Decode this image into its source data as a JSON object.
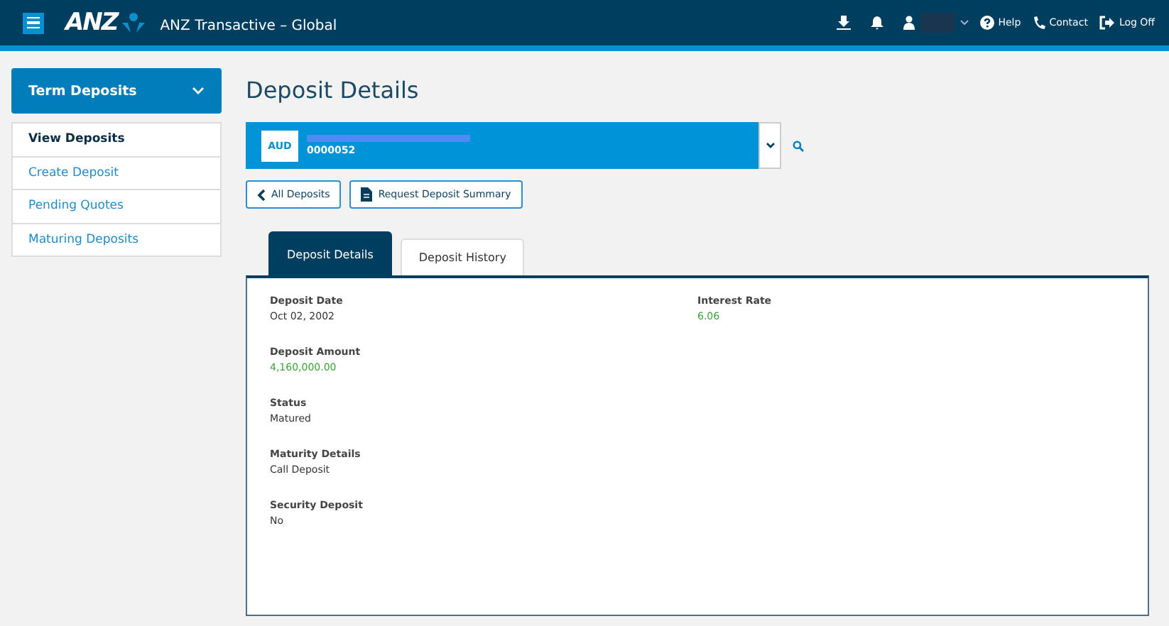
{
  "header": {
    "app_title": "ANZ Transactive – Global",
    "logo": "ANZ",
    "links": [
      {
        "label": "Help",
        "kind": "help"
      },
      {
        "label": "Contact",
        "kind": "contact"
      },
      {
        "label": "Log Off",
        "kind": "logoff"
      }
    ]
  },
  "sidebar": {
    "title": "Term Deposits",
    "expanded": true,
    "items": [
      {
        "label": "View Deposits",
        "selected": true
      },
      {
        "label": "Create Deposit",
        "selected": false
      },
      {
        "label": "Pending Quotes",
        "selected": false
      },
      {
        "label": "Maturing Deposits",
        "selected": false
      }
    ]
  },
  "page_title": "Deposit Details",
  "account": {
    "currency": "AUD",
    "number": "0000052"
  },
  "buttons": [
    {
      "label": "All Deposits",
      "kind": "back"
    },
    {
      "label": "Request Deposit Summary",
      "kind": "summary"
    }
  ],
  "tabs": [
    {
      "label": "Deposit Details",
      "selected": true
    },
    {
      "label": "Deposit History",
      "selected": false
    }
  ],
  "fields_left": [
    {
      "label": "Deposit Date",
      "value": "Oct 02, 2002",
      "color": "#333333"
    },
    {
      "label": "Deposit Amount",
      "value": "4,160,000.00",
      "color": "#3aa335"
    },
    {
      "label": "Status",
      "value": "Matured",
      "color": "#333333"
    },
    {
      "label": "Maturity Details",
      "value": "Call Deposit",
      "color": "#333333"
    },
    {
      "label": "Security Deposit",
      "value": "No",
      "color": "#333333"
    }
  ],
  "fields_right": [
    {
      "label": "Interest Rate",
      "value": "6.06",
      "color": "#3aa335"
    }
  ]
}
